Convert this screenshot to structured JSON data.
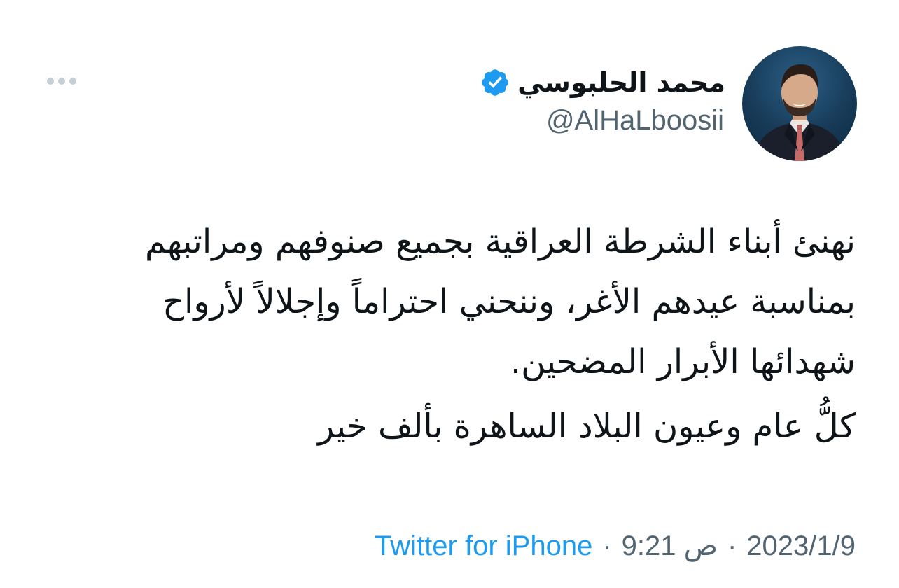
{
  "author": {
    "display_name": "محمد الحلبوسي",
    "handle": "@AlHaLboosii",
    "verified": true,
    "verified_color": "#1d9bf0"
  },
  "tweet": {
    "paragraphs": [
      "نهنئ أبناء الشرطة العراقية بجميع صنوفهم ومراتبهم بمناسبة عيدهم الأغر، وننحني احتراماً وإجلالاً لأرواح شهدائها الأبرار المضحين.",
      "كلُّ عام وعيون البلاد الساهرة بألف خير"
    ]
  },
  "meta": {
    "source": "Twitter for iPhone",
    "separator": "·",
    "time": "9:21 ص",
    "date": "2023/1/9"
  },
  "icons": {
    "more": "more-horizontal-icon",
    "verified": "verified-badge-icon"
  },
  "colors": {
    "text": "#0f1419",
    "secondary": "#536471",
    "link": "#1d9bf0",
    "background": "#ffffff"
  }
}
